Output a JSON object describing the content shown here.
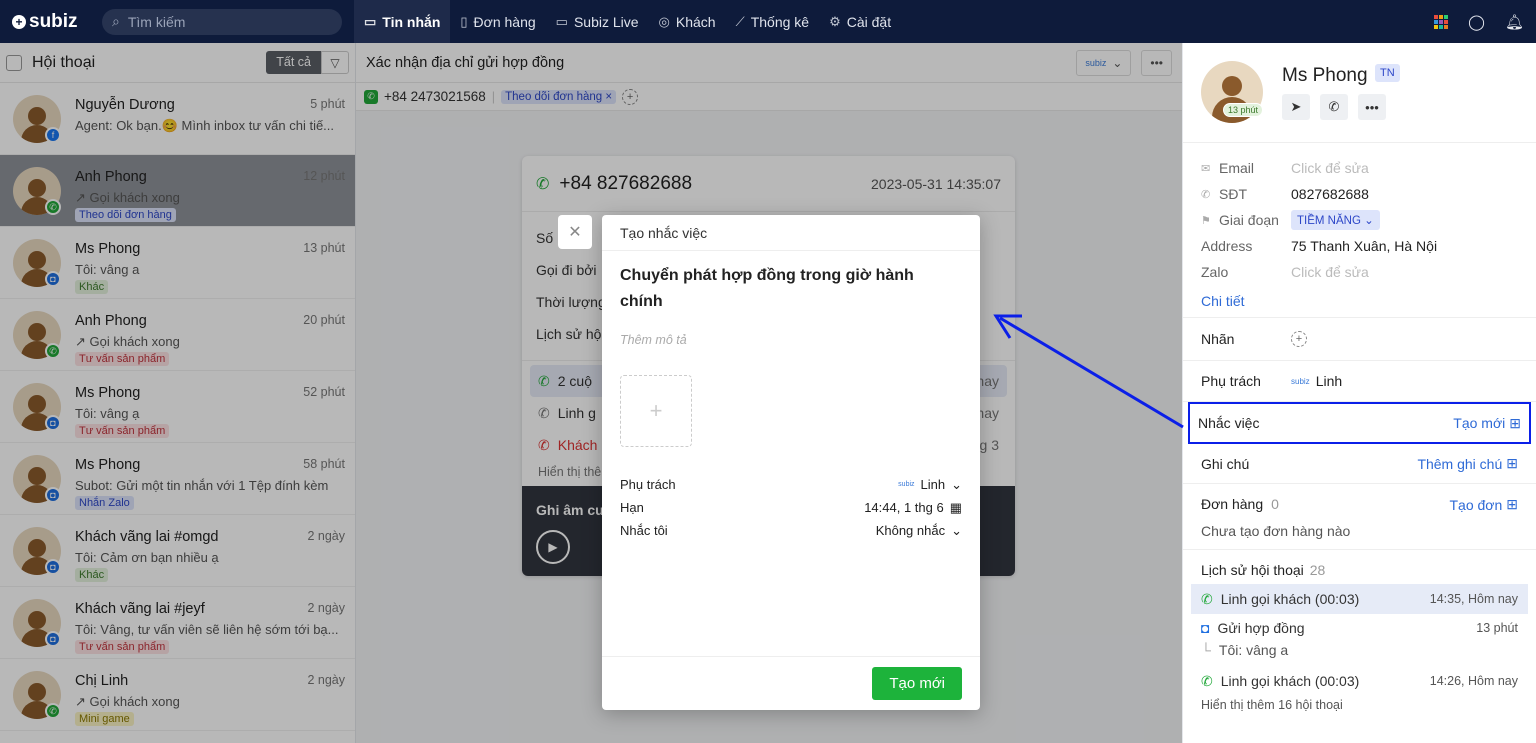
{
  "topbar": {
    "logo": "subiz",
    "search_placeholder": "Tìm kiếm",
    "nav": [
      {
        "label": "Tin nhắn",
        "icon": "chat-icon",
        "active": true
      },
      {
        "label": "Đơn hàng",
        "icon": "order-icon"
      },
      {
        "label": "Subiz Live",
        "icon": "monitor-icon"
      },
      {
        "label": "Khách",
        "icon": "user-icon"
      },
      {
        "label": "Thống kê",
        "icon": "chart-icon"
      },
      {
        "label": "Cài đặt",
        "icon": "gear-icon"
      }
    ]
  },
  "conversations": {
    "title": "Hội thoại",
    "filter_all": "Tất cả",
    "items": [
      {
        "name": "Nguyễn Dương",
        "time": "5 phút",
        "msg": "Agent: Ok bạn.😊 Mình inbox tư vấn chi tiế...",
        "tag": "",
        "channel": "facebook"
      },
      {
        "name": "Anh Phong",
        "time": "12 phút",
        "msg": "↗ Gọi khách xong",
        "tag": "Theo dõi đơn hàng",
        "channel": "phone"
      },
      {
        "name": "Ms Phong",
        "time": "13 phút",
        "msg": "Tôi: vâng a",
        "tag": "Khác",
        "channel": "web"
      },
      {
        "name": "Anh Phong",
        "time": "20 phút",
        "msg": "↗ Gọi khách xong",
        "tag": "Tư vấn sản phẩm",
        "channel": "phone"
      },
      {
        "name": "Ms Phong",
        "time": "52 phút",
        "msg": "Tôi: vâng ạ",
        "tag": "Tư vấn sản phẩm",
        "channel": "web"
      },
      {
        "name": "Ms Phong",
        "time": "58 phút",
        "msg": "Subot: Gửi một tin nhắn với 1 Tệp đính kèm",
        "tag": "Nhắn Zalo",
        "channel": "web"
      },
      {
        "name": "Khách vãng lai #omgd",
        "time": "2 ngày",
        "msg": "Tôi: Cảm ơn bạn nhiều ạ",
        "tag": "Khác",
        "channel": "web"
      },
      {
        "name": "Khách vãng lai #jeyf",
        "time": "2 ngày",
        "msg": "Tôi: Vâng, tư vấn viên sẽ liên hệ sớm tới bạ...",
        "tag": "Tư vấn sản phẩm",
        "channel": "web"
      },
      {
        "name": "Chị Linh",
        "time": "2 ngày",
        "msg": "↗ Gọi khách xong",
        "tag": "Mini game",
        "channel": "phone"
      }
    ]
  },
  "middle": {
    "title": "Xác nhận địa chỉ gửi hợp đồng",
    "phone": "+84 2473021568",
    "chip": "Theo dõi đơn hàng",
    "call": {
      "phone": "+84 827682688",
      "datetime": "2023-05-31 14:35:07",
      "rows": [
        "Số",
        "Gọi đi bởi",
        "Thời lượng",
        "Lịch sử hộ"
      ],
      "list": [
        "2 cuộ",
        "Linh g",
        "Khách"
      ],
      "list_right": [
        "nay",
        "nay",
        "g 3"
      ],
      "more": "Hiển thị thê",
      "rec": "Ghi âm cu"
    }
  },
  "modal": {
    "header": "Tạo nhắc việc",
    "title": "Chuyển phát hợp đồng trong giờ hành chính",
    "desc_placeholder": "Thêm mô tả",
    "fields": [
      {
        "label": "Phụ trách",
        "value": "Linh"
      },
      {
        "label": "Hạn",
        "value": "14:44, 1 thg 6"
      },
      {
        "label": "Nhắc tôi",
        "value": "Không nhắc"
      }
    ],
    "submit": "Tạo mới"
  },
  "contact": {
    "name": "Ms Phong",
    "badge": "TN",
    "avatar_time": "13 phút",
    "info": [
      {
        "key": "Email",
        "value": "Click để sửa",
        "placeholder": true
      },
      {
        "key": "SĐT",
        "value": "0827682688"
      },
      {
        "key": "Giai đoạn",
        "value": "TIỀM NĂNG"
      },
      {
        "key": "Address",
        "value": "75 Thanh Xuân, Hà Nội"
      },
      {
        "key": "Zalo",
        "value": "Click để sửa",
        "placeholder": true
      }
    ],
    "detail": "Chi tiết",
    "labels": "Nhãn",
    "owner_label": "Phụ trách",
    "owner": "Linh",
    "reminder": "Nhắc việc",
    "reminder_new": "Tạo mới",
    "note": "Ghi chú",
    "note_add": "Thêm ghi chú",
    "order": "Đơn hàng",
    "order_count": "0",
    "order_new": "Tạo đơn",
    "order_empty": "Chưa tạo đơn hàng nào",
    "history": "Lịch sử hội thoại",
    "history_count": "28",
    "history_items": [
      {
        "title": "Linh gọi khách (00:03)",
        "time": "14:35, Hôm nay"
      },
      {
        "title": "Gửi hợp đồng",
        "time": "13 phút",
        "sub": "Tôi: vâng a"
      },
      {
        "title": "Linh gọi khách (00:03)",
        "time": "14:26, Hôm nay"
      }
    ],
    "history_more": "Hiển thị thêm 16 hội thoại"
  },
  "colors": {
    "accent": "#2e6ad6",
    "topbar": "#0e1b3b",
    "success": "#1db33b",
    "annotation": "#0b1fe8"
  }
}
